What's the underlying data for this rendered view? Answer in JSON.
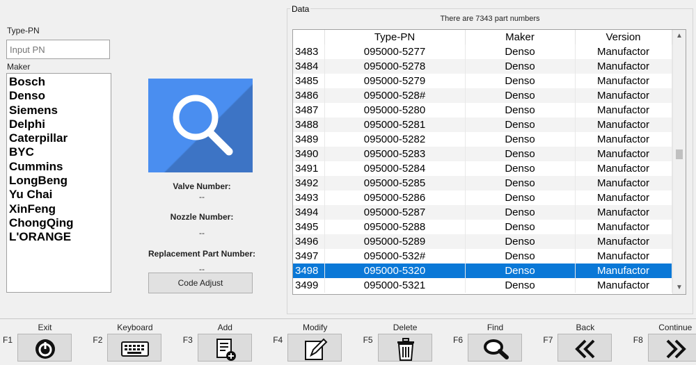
{
  "left": {
    "typepn_label": "Type-PN",
    "pn_placeholder": "Input PN",
    "maker_label": "Maker",
    "makers": [
      "Bosch",
      "Denso",
      "Siemens",
      "Delphi",
      "Caterpillar",
      "BYC",
      "Cummins",
      "LongBeng",
      "Yu Chai",
      "XinFeng",
      "ChongQing",
      "L'ORANGE"
    ]
  },
  "center": {
    "search_icon": "magnifier-icon",
    "valve_label": "Valve Number:",
    "valve_value": "--",
    "nozzle_label": "Nozzle Number:",
    "nozzle_value": "--",
    "replacement_label": "Replacement Part Number:",
    "replacement_value": "--",
    "code_adjust_label": "Code Adjust"
  },
  "data": {
    "group_title": "Data",
    "count_text": "There are 7343 part numbers",
    "columns": [
      "",
      "Type-PN",
      "Maker",
      "Version"
    ],
    "selected_index": 15,
    "rows": [
      [
        "3483",
        "095000-5277",
        "Denso",
        "Manufactor"
      ],
      [
        "3484",
        "095000-5278",
        "Denso",
        "Manufactor"
      ],
      [
        "3485",
        "095000-5279",
        "Denso",
        "Manufactor"
      ],
      [
        "3486",
        "095000-528#",
        "Denso",
        "Manufactor"
      ],
      [
        "3487",
        "095000-5280",
        "Denso",
        "Manufactor"
      ],
      [
        "3488",
        "095000-5281",
        "Denso",
        "Manufactor"
      ],
      [
        "3489",
        "095000-5282",
        "Denso",
        "Manufactor"
      ],
      [
        "3490",
        "095000-5283",
        "Denso",
        "Manufactor"
      ],
      [
        "3491",
        "095000-5284",
        "Denso",
        "Manufactor"
      ],
      [
        "3492",
        "095000-5285",
        "Denso",
        "Manufactor"
      ],
      [
        "3493",
        "095000-5286",
        "Denso",
        "Manufactor"
      ],
      [
        "3494",
        "095000-5287",
        "Denso",
        "Manufactor"
      ],
      [
        "3495",
        "095000-5288",
        "Denso",
        "Manufactor"
      ],
      [
        "3496",
        "095000-5289",
        "Denso",
        "Manufactor"
      ],
      [
        "3497",
        "095000-532#",
        "Denso",
        "Manufactor"
      ],
      [
        "3498",
        "095000-5320",
        "Denso",
        "Manufactor"
      ],
      [
        "3499",
        "095000-5321",
        "Denso",
        "Manufactor"
      ]
    ],
    "scroll_up": "▲",
    "scroll_down": "▼"
  },
  "colors": {
    "accent_blue": "#4a8ef0",
    "selection": "#0a78d7"
  },
  "fkeys": [
    {
      "key": "F1",
      "caption": "Exit",
      "icon": "power-icon"
    },
    {
      "key": "F2",
      "caption": "Keyboard",
      "icon": "keyboard-icon"
    },
    {
      "key": "F3",
      "caption": "Add",
      "icon": "add-list-icon"
    },
    {
      "key": "F4",
      "caption": "Modify",
      "icon": "edit-icon"
    },
    {
      "key": "F5",
      "caption": "Delete",
      "icon": "trash-icon"
    },
    {
      "key": "F6",
      "caption": "Find",
      "icon": "search-icon"
    },
    {
      "key": "F7",
      "caption": "Back",
      "icon": "double-chevron-left-icon"
    },
    {
      "key": "F8",
      "caption": "Continue",
      "icon": "double-chevron-right-icon"
    }
  ]
}
